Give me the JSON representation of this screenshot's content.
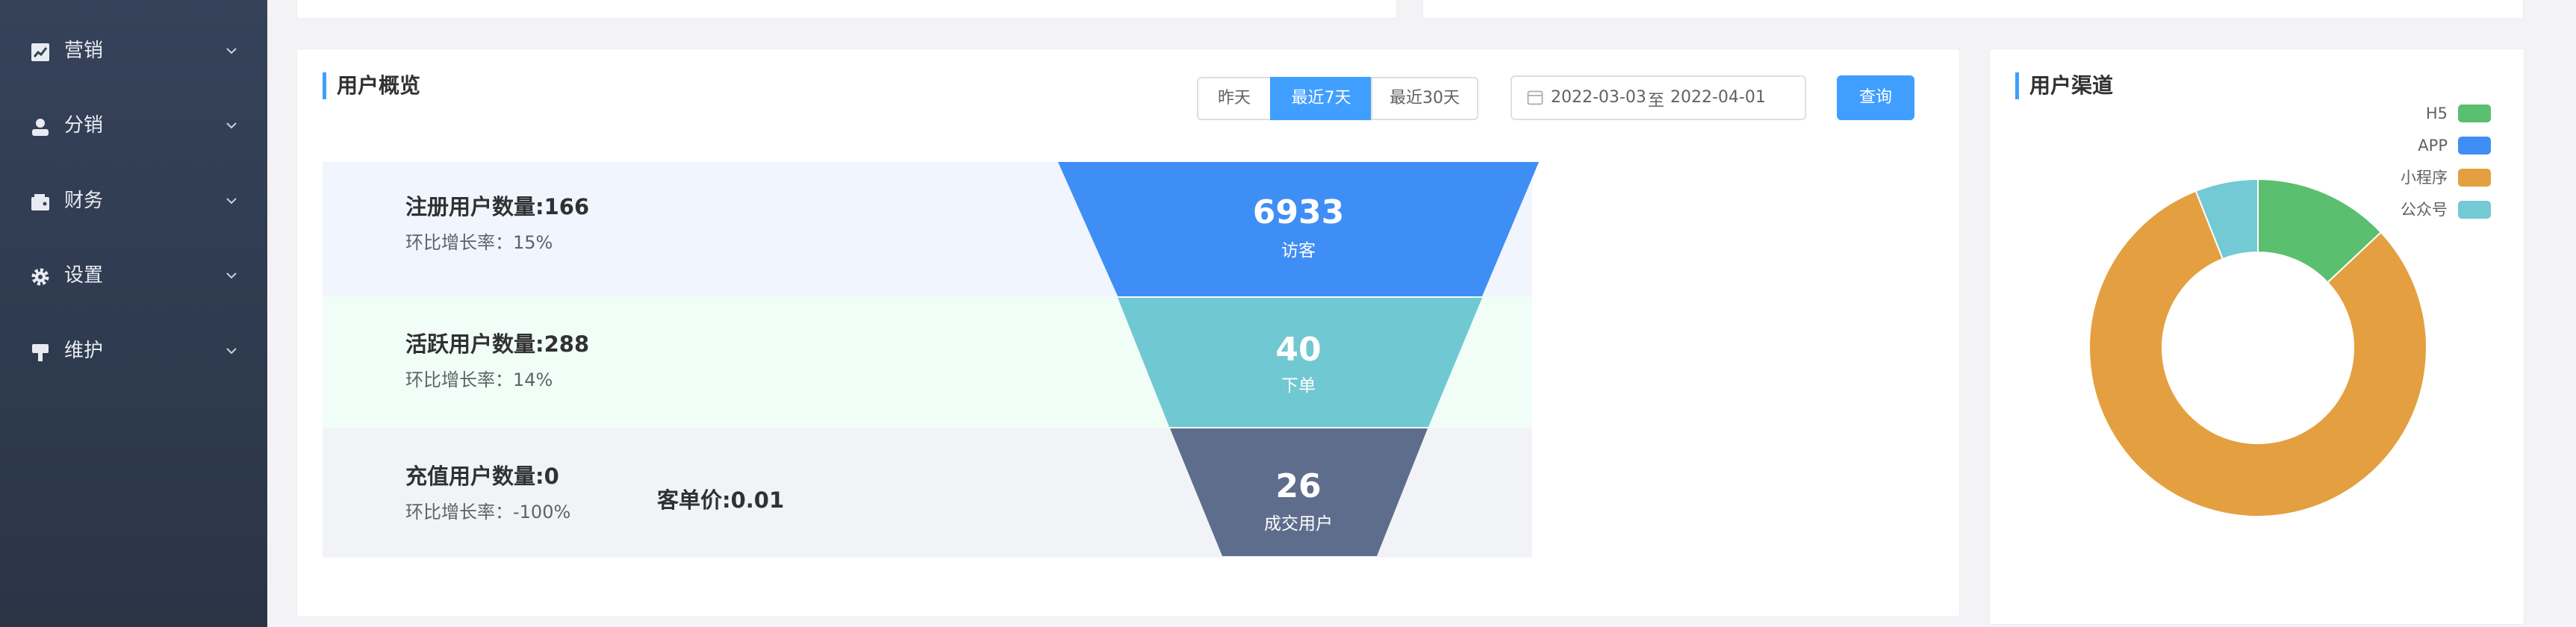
{
  "sidebar": {
    "items": [
      {
        "label": "营销",
        "icon": "chart-icon"
      },
      {
        "label": "分销",
        "icon": "user-icon"
      },
      {
        "label": "财务",
        "icon": "wallet-icon"
      },
      {
        "label": "设置",
        "icon": "gear-icon"
      },
      {
        "label": "维护",
        "icon": "brush-icon"
      }
    ]
  },
  "overview": {
    "title": "用户概览",
    "range_buttons": [
      "昨天",
      "最近7天",
      "最近30天"
    ],
    "active_range": "最近7天",
    "date_start": "2022-03-03",
    "date_sep": "至",
    "date_end": "2022-04-01",
    "query_label": "查询",
    "rows": [
      {
        "title": "注册用户数量:166",
        "growth": "环比增长率：15%",
        "funnel_value": "6933",
        "funnel_label": "访客"
      },
      {
        "title": "活跃用户数量:288",
        "growth": "环比增长率：14%",
        "funnel_value": "40",
        "funnel_label": "下单"
      },
      {
        "title": "充值用户数量:0",
        "growth": "环比增长率：-100%",
        "extra": "客单价:0.01",
        "funnel_value": "26",
        "funnel_label": "成交用户"
      }
    ],
    "colors": {
      "stage1": "#3f8ef5",
      "stage2": "#70c8d2",
      "stage3": "#5f6d8d",
      "band1": "#f1f5fe",
      "band2": "#f1fdf7",
      "band3": "#f1f3f7"
    }
  },
  "channels": {
    "title": "用户渠道",
    "chart_data": {
      "type": "pie",
      "title": "",
      "categories": [
        "H5",
        "APP",
        "小程序",
        "公众号"
      ],
      "values": [
        13,
        0,
        81,
        6
      ],
      "colors": [
        "#5abf6e",
        "#3f8ef5",
        "#e4a040",
        "#73c9d4"
      ],
      "legend_position": "top-right"
    }
  }
}
